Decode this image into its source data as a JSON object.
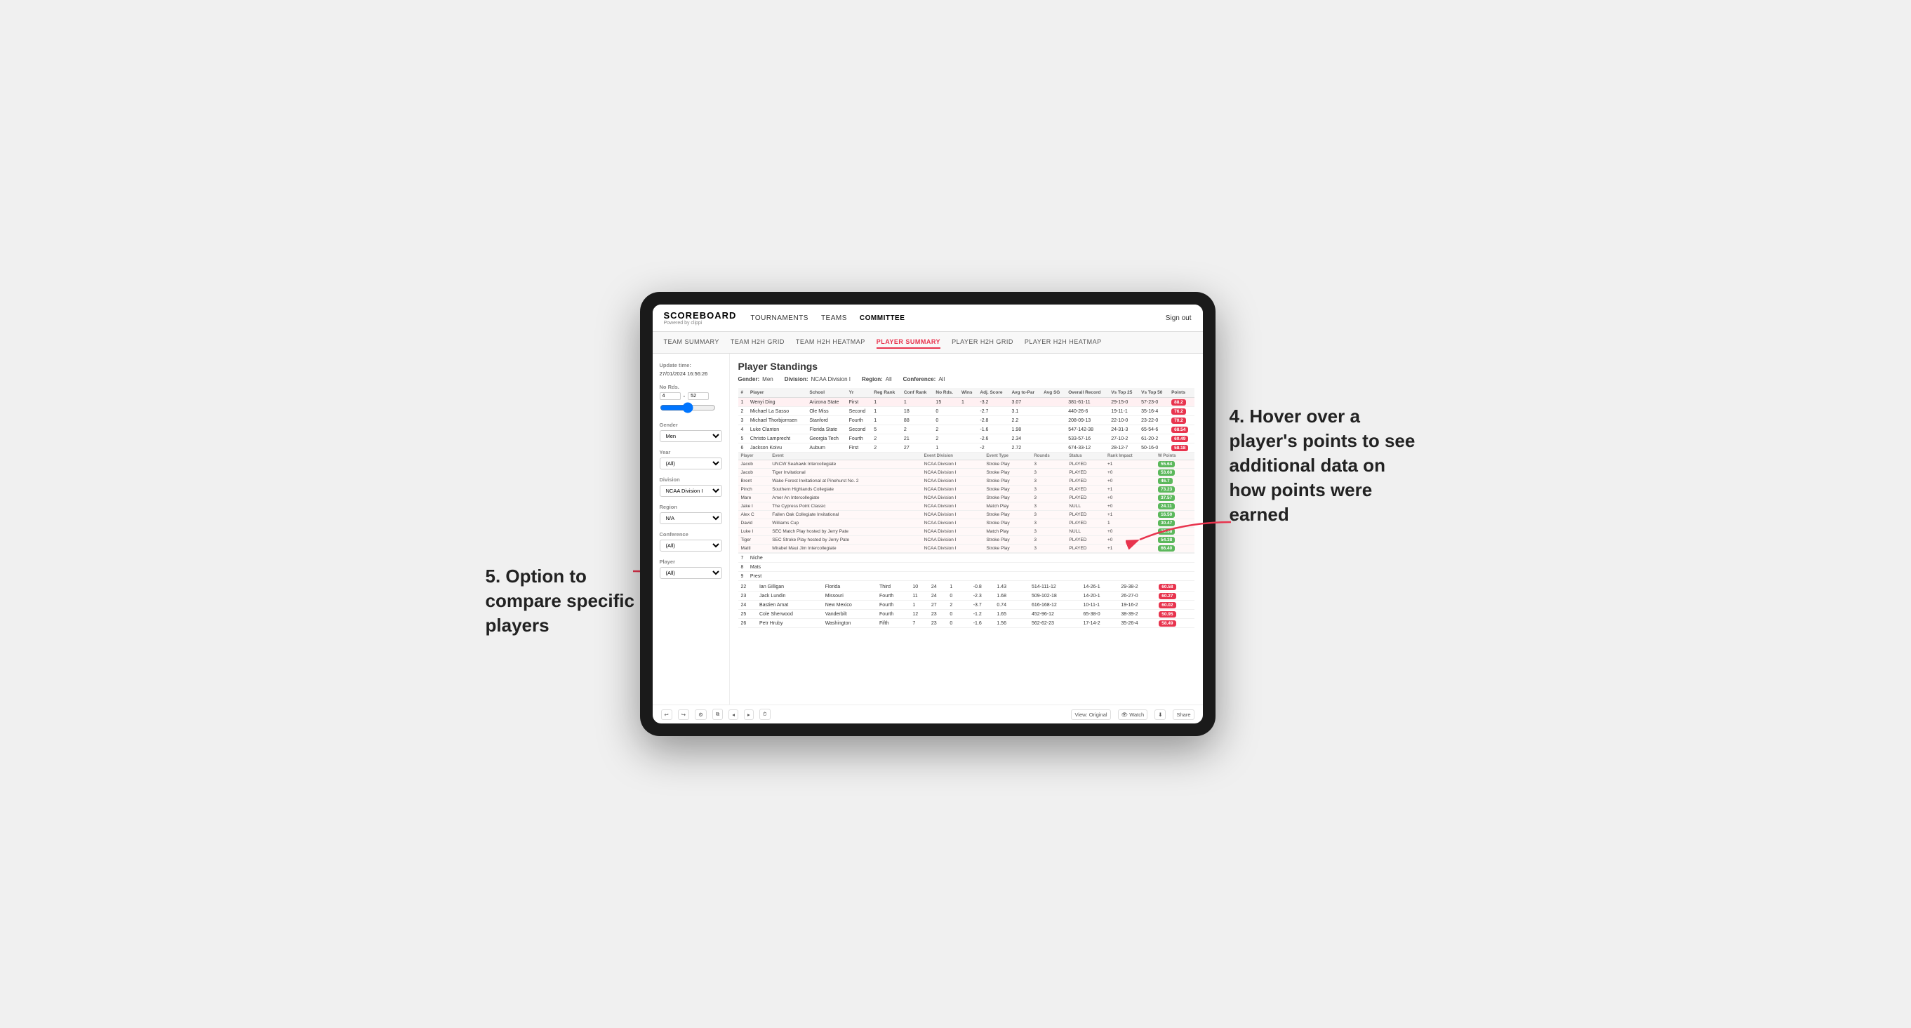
{
  "layout": {
    "ipad_width": 820
  },
  "annotations": {
    "top_right": "4. Hover over a player's points to see additional data on how points were earned",
    "bottom_left": "5. Option to compare specific players"
  },
  "nav": {
    "logo": "SCOREBOARD",
    "logo_sub": "Powered by clippi",
    "links": [
      "TOURNAMENTS",
      "TEAMS",
      "COMMITTEE"
    ],
    "sign_out": "Sign out"
  },
  "sub_nav": {
    "links": [
      "TEAM SUMMARY",
      "TEAM H2H GRID",
      "TEAM H2H HEATMAP",
      "PLAYER SUMMARY",
      "PLAYER H2H GRID",
      "PLAYER H2H HEATMAP"
    ],
    "active": "PLAYER SUMMARY"
  },
  "sidebar": {
    "update_time_label": "Update time:",
    "update_time": "27/01/2024 16:56:26",
    "no_rds_label": "No Rds.",
    "no_rds_min": "4",
    "no_rds_max": "52",
    "gender_label": "Gender",
    "gender_value": "Men",
    "year_label": "Year",
    "year_value": "(All)",
    "division_label": "Division",
    "division_value": "NCAA Division I",
    "region_label": "Region",
    "region_value": "N/A",
    "conference_label": "Conference",
    "conference_value": "(All)",
    "player_label": "Player",
    "player_value": "(All)"
  },
  "content": {
    "title": "Player Standings",
    "filters": {
      "gender": "Men",
      "division": "NCAA Division I",
      "region": "All",
      "conference": "All"
    },
    "table_headers": [
      "#",
      "Player",
      "School",
      "Yr",
      "Reg Rank",
      "Conf Rank",
      "No Rds.",
      "Wins",
      "Adj. Score",
      "Avg to-Par",
      "Avg SG",
      "Overall Record",
      "Vs Top 25",
      "Vs Top 50",
      "Points"
    ],
    "rows": [
      {
        "num": 1,
        "player": "Wenyi Ding",
        "school": "Arizona State",
        "yr": "First",
        "reg_rank": 1,
        "conf_rank": 1,
        "rds": 15,
        "wins": 1,
        "adj_score": -3.2,
        "to_par": 3.07,
        "sg": "",
        "record": "381-61-11",
        "vs_top25": "29-15-0",
        "vs_top50": "57-23-0",
        "points": "88.2",
        "highlight": true
      },
      {
        "num": 2,
        "player": "Michael La Sasso",
        "school": "Ole Miss",
        "yr": "Second",
        "reg_rank": 1,
        "conf_rank": 18,
        "rds": 0,
        "wins": "",
        "adj_score": -2.7,
        "to_par": 3.1,
        "sg": "",
        "record": "440-26-6",
        "vs_top25": "19-11-1",
        "vs_top50": "35-16-4",
        "points": "76.2",
        "highlight": false
      },
      {
        "num": 3,
        "player": "Michael Thorbjornsen",
        "school": "Stanford",
        "yr": "Fourth",
        "reg_rank": 1,
        "conf_rank": 88,
        "rds": 0,
        "wins": "",
        "adj_score": -2.8,
        "to_par": 2.2,
        "sg": "",
        "record": "208-09-13",
        "vs_top25": "22-10-0",
        "vs_top50": "23-22-0",
        "points": "70.2",
        "highlight": false
      },
      {
        "num": 4,
        "player": "Luke Clanton",
        "school": "Florida State",
        "yr": "Second",
        "reg_rank": 5,
        "conf_rank": 2,
        "rds": 2,
        "wins": "",
        "adj_score": -1.6,
        "to_par": 1.98,
        "sg": "",
        "record": "547-142-38",
        "vs_top25": "24-31-3",
        "vs_top50": "65-54-6",
        "points": "68.54",
        "highlight": false
      },
      {
        "num": 5,
        "player": "Christo Lamprecht",
        "school": "Georgia Tech",
        "yr": "Fourth",
        "reg_rank": 2,
        "conf_rank": 21,
        "rds": 2,
        "wins": "",
        "adj_score": -2.6,
        "to_par": 2.34,
        "sg": "",
        "record": "533-57-16",
        "vs_top25": "27-10-2",
        "vs_top50": "61-20-2",
        "points": "60.49",
        "highlight": false
      },
      {
        "num": 6,
        "player": "Jackson Koivu",
        "school": "Auburn",
        "yr": "First",
        "reg_rank": 2,
        "conf_rank": 27,
        "rds": 1,
        "wins": "",
        "adj_score": -2.0,
        "to_par": 2.72,
        "sg": "",
        "record": "674-33-12",
        "vs_top25": "28-12-7",
        "vs_top50": "50-16-0",
        "points": "58.18",
        "highlight": false
      },
      {
        "num": 7,
        "player": "Niche",
        "school": "",
        "yr": "",
        "reg_rank": "",
        "conf_rank": "",
        "rds": "",
        "wins": "",
        "adj_score": "",
        "to_par": "",
        "sg": "",
        "record": "",
        "vs_top25": "",
        "vs_top50": "",
        "points": "",
        "highlight": false
      },
      {
        "num": 8,
        "player": "Mats",
        "school": "",
        "yr": "",
        "reg_rank": "",
        "conf_rank": "",
        "rds": "",
        "wins": "",
        "adj_score": "",
        "to_par": "",
        "sg": "",
        "record": "",
        "vs_top25": "",
        "vs_top50": "",
        "points": "",
        "highlight": false
      },
      {
        "num": 9,
        "player": "Prest",
        "school": "",
        "yr": "",
        "reg_rank": "",
        "conf_rank": "",
        "rds": "",
        "wins": "",
        "adj_score": "",
        "to_par": "",
        "sg": "",
        "record": "",
        "vs_top25": "",
        "vs_top50": "",
        "points": "",
        "highlight": false
      }
    ],
    "popup_player": "Jackson Koivu",
    "popup_headers": [
      "Player",
      "Event",
      "Event Division",
      "Event Type",
      "Rounds",
      "Status",
      "Rank Impact",
      "W Points"
    ],
    "popup_rows": [
      {
        "player": "Jacob",
        "event": "UNCW Seahawk Intercollegiate",
        "division": "NCAA Division I",
        "type": "Stroke Play",
        "rounds": 3,
        "status": "PLAYED",
        "rank_impact": "+1",
        "w_points": "55.64"
      },
      {
        "player": "Jacob",
        "event": "Tiger Invitational",
        "division": "NCAA Division I",
        "type": "Stroke Play",
        "rounds": 3,
        "status": "PLAYED",
        "rank_impact": "+0",
        "w_points": "53.60"
      },
      {
        "player": "Brent",
        "event": "Wake Forest Invitational at Pinehurst No. 2",
        "division": "NCAA Division I",
        "type": "Stroke Play",
        "rounds": 3,
        "status": "PLAYED",
        "rank_impact": "+0",
        "w_points": "46.7"
      },
      {
        "player": "Pinch",
        "event": "Southern Highlands Collegiate",
        "division": "NCAA Division I",
        "type": "Stroke Play",
        "rounds": 3,
        "status": "PLAYED",
        "rank_impact": "+1",
        "w_points": "73.23"
      },
      {
        "player": "Mare",
        "event": "Amer An Intercollegiate",
        "division": "NCAA Division I",
        "type": "Stroke Play",
        "rounds": 3,
        "status": "PLAYED",
        "rank_impact": "+0",
        "w_points": "37.57"
      },
      {
        "player": "Jake I",
        "event": "The Cypress Point Classic",
        "division": "NCAA Division I",
        "type": "Match Play",
        "rounds": 3,
        "status": "NULL",
        "rank_impact": "+0",
        "w_points": "24.11"
      },
      {
        "player": "Alex C",
        "event": "Fallen Oak Collegiate Invitational",
        "division": "NCAA Division I",
        "type": "Stroke Play",
        "rounds": 3,
        "status": "PLAYED",
        "rank_impact": "+1",
        "w_points": "16.50"
      },
      {
        "player": "David",
        "event": "Williams Cup",
        "division": "NCAA Division I",
        "type": "Stroke Play",
        "rounds": 3,
        "status": "PLAYED",
        "rank_impact": "1",
        "w_points": "30.47"
      },
      {
        "player": "Luke I",
        "event": "SEC Match Play hosted by Jerry Pate",
        "division": "NCAA Division I",
        "type": "Match Play",
        "rounds": 3,
        "status": "NULL",
        "rank_impact": "+0",
        "w_points": "25.38"
      },
      {
        "player": "Tiger",
        "event": "SEC Stroke Play hosted by Jerry Pate",
        "division": "NCAA Division I",
        "type": "Stroke Play",
        "rounds": 3,
        "status": "PLAYED",
        "rank_impact": "+0",
        "w_points": "54.38"
      },
      {
        "player": "Mattl",
        "event": "Mirabel Maui Jim Intercollegiate",
        "division": "NCAA Division I",
        "type": "Stroke Play",
        "rounds": 3,
        "status": "PLAYED",
        "rank_impact": "+1",
        "w_points": "66.40"
      }
    ],
    "lower_rows": [
      {
        "num": 22,
        "player": "Ian Gilligan",
        "school": "Florida",
        "yr": "Third",
        "reg_rank": 10,
        "conf_rank": 24,
        "rds": 1,
        "wins": "",
        "adj_score": -0.8,
        "to_par": 1.43,
        "sg": "",
        "record": "514-111-12",
        "vs_top25": "14-26-1",
        "vs_top50": "29-38-2",
        "points": "60.58"
      },
      {
        "num": 23,
        "player": "Jack Lundin",
        "school": "Missouri",
        "yr": "Fourth",
        "reg_rank": 11,
        "conf_rank": 24,
        "rds": 0,
        "wins": "",
        "adj_score": -2.3,
        "to_par": 1.68,
        "sg": "",
        "record": "509-102-18",
        "vs_top25": "14-20-1",
        "vs_top50": "26-27-0",
        "points": "60.27"
      },
      {
        "num": 24,
        "player": "Bastien Amat",
        "school": "New Mexico",
        "yr": "Fourth",
        "reg_rank": 1,
        "conf_rank": 27,
        "rds": 2,
        "wins": "",
        "adj_score": -3.7,
        "to_par": 0.74,
        "sg": "",
        "record": "616-168-12",
        "vs_top25": "10-11-1",
        "vs_top50": "19-16-2",
        "points": "60.02"
      },
      {
        "num": 25,
        "player": "Cole Sherwood",
        "school": "Vanderbilt",
        "yr": "Fourth",
        "reg_rank": 12,
        "conf_rank": 23,
        "rds": 0,
        "wins": "",
        "adj_score": -1.2,
        "to_par": 1.65,
        "sg": "",
        "record": "452-96-12",
        "vs_top25": "65-38-0",
        "vs_top50": "38-39-2",
        "points": "50.95"
      },
      {
        "num": 26,
        "player": "Petr Hruby",
        "school": "Washington",
        "yr": "Fifth",
        "reg_rank": 7,
        "conf_rank": 23,
        "rds": 0,
        "wins": "",
        "adj_score": -1.6,
        "to_par": 1.56,
        "sg": "",
        "record": "562-62-23",
        "vs_top25": "17-14-2",
        "vs_top50": "35-26-4",
        "points": "58.49"
      }
    ]
  },
  "toolbar": {
    "view_label": "View: Original",
    "watch_label": "Watch",
    "share_label": "Share"
  }
}
